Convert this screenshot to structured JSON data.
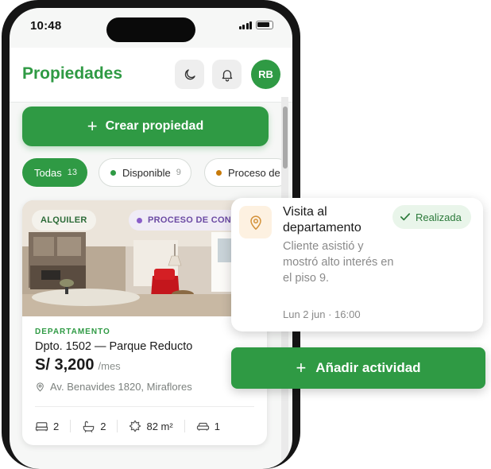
{
  "status_bar": {
    "time": "10:48"
  },
  "header": {
    "title": "Propiedades",
    "avatar_initials": "RB"
  },
  "create_button": {
    "label": "Crear propiedad"
  },
  "filters": [
    {
      "label": "Todas",
      "count": "13",
      "active": true
    },
    {
      "label": "Disponible",
      "count": "9",
      "dot_color": "#2f9a44"
    },
    {
      "label": "Proceso de",
      "dot_color": "#c77a0a"
    }
  ],
  "property_card": {
    "tag_rent": "ALQUILER",
    "tag_process": "PROCESO DE CONTR",
    "type": "DEPARTAMENTO",
    "name": "Dpto. 1502 — Parque Reducto",
    "price": "S/ 3,200",
    "price_period": "/mes",
    "address": "Av. Benavides 1820, Miraflores",
    "features": {
      "bedrooms": "2",
      "bathrooms": "2",
      "area": "82 m²",
      "parking": "1"
    }
  },
  "activity_card": {
    "title": "Visita al departamento",
    "status": "Realizada",
    "description": "Cliente asistió y mostró alto interés en el piso 9.",
    "date": "Lun 2 jun · 16:00"
  },
  "add_activity_button": {
    "label": "Añadir actividad"
  },
  "colors": {
    "brand_green": "#2f9a44",
    "process_purple": "#6b4aa3",
    "location_orange": "#d4923a"
  }
}
